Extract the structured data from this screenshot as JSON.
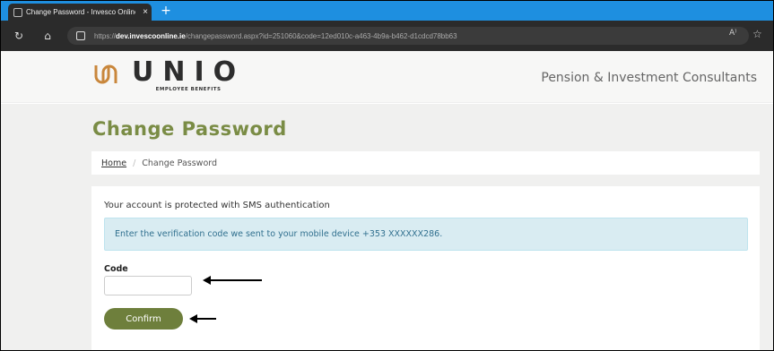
{
  "browser": {
    "tab_title": "Change Password - Invesco Online",
    "tab_close": "×",
    "new_tab": "+",
    "url_prefix": "https://",
    "url_host": "dev.invescoonline.ie",
    "url_path": "/changepassword.aspx?id=251060&code=12ed010c-a463-4b9a-b462-d1cdcd78bb63",
    "read_aloud": "A⁾",
    "favorite": "☆"
  },
  "header": {
    "logo_word": "UNIO",
    "logo_sub": "EMPLOYEE BENEFITS",
    "tagline": "Pension & Investment Consultants",
    "brand_color": "#7a8c45"
  },
  "page": {
    "title": "Change Password",
    "breadcrumb": {
      "home": "Home",
      "separator": "/",
      "current": "Change Password"
    },
    "sms_notice": "Your account is protected with SMS authentication",
    "alert_text": "Enter the verification code we sent to your mobile device +353 XXXXXX286.",
    "code_label": "Code",
    "code_value": "",
    "confirm_label": "Confirm"
  }
}
